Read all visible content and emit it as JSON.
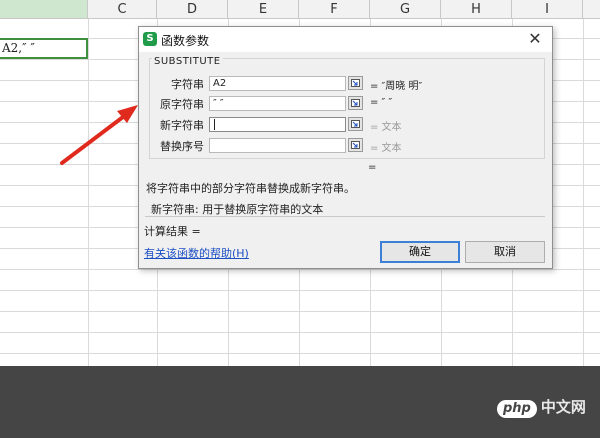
{
  "sheet": {
    "columns": [
      "C",
      "D",
      "E",
      "F",
      "G",
      "H",
      "I"
    ],
    "active_cell_text": "A2,″ ″"
  },
  "dialog": {
    "title": "函数参数",
    "function_name": "SUBSTITUTE",
    "args": [
      {
        "label": "字符串",
        "value": "A2",
        "result": "= ″周晓    明″",
        "focused": false
      },
      {
        "label": "原字符串",
        "value": "″ ″",
        "result": "= ″ ″",
        "focused": false
      },
      {
        "label": "新字符串",
        "value": "",
        "result": "= 文本",
        "focused": true
      },
      {
        "label": "替换序号",
        "value": "",
        "result": "= 文本",
        "focused": false
      }
    ],
    "formula_result": "=",
    "description": "将字符串中的部分字符串替换成新字符串。",
    "param_description": "新字符串: 用于替换原字符串的文本",
    "calc_result": "计算结果 =",
    "help_link": "有关该函数的帮助(H)",
    "ok_label": "确定",
    "cancel_label": "取消",
    "close_glyph": "✕",
    "app_icon_glyph": "S"
  },
  "watermark": {
    "badge": "php",
    "text": "中文网"
  },
  "colors": {
    "accent": "#3c7fd6",
    "link": "#1c4fc4",
    "arrow": "#e02a1e",
    "app_icon": "#1f9b4a"
  }
}
